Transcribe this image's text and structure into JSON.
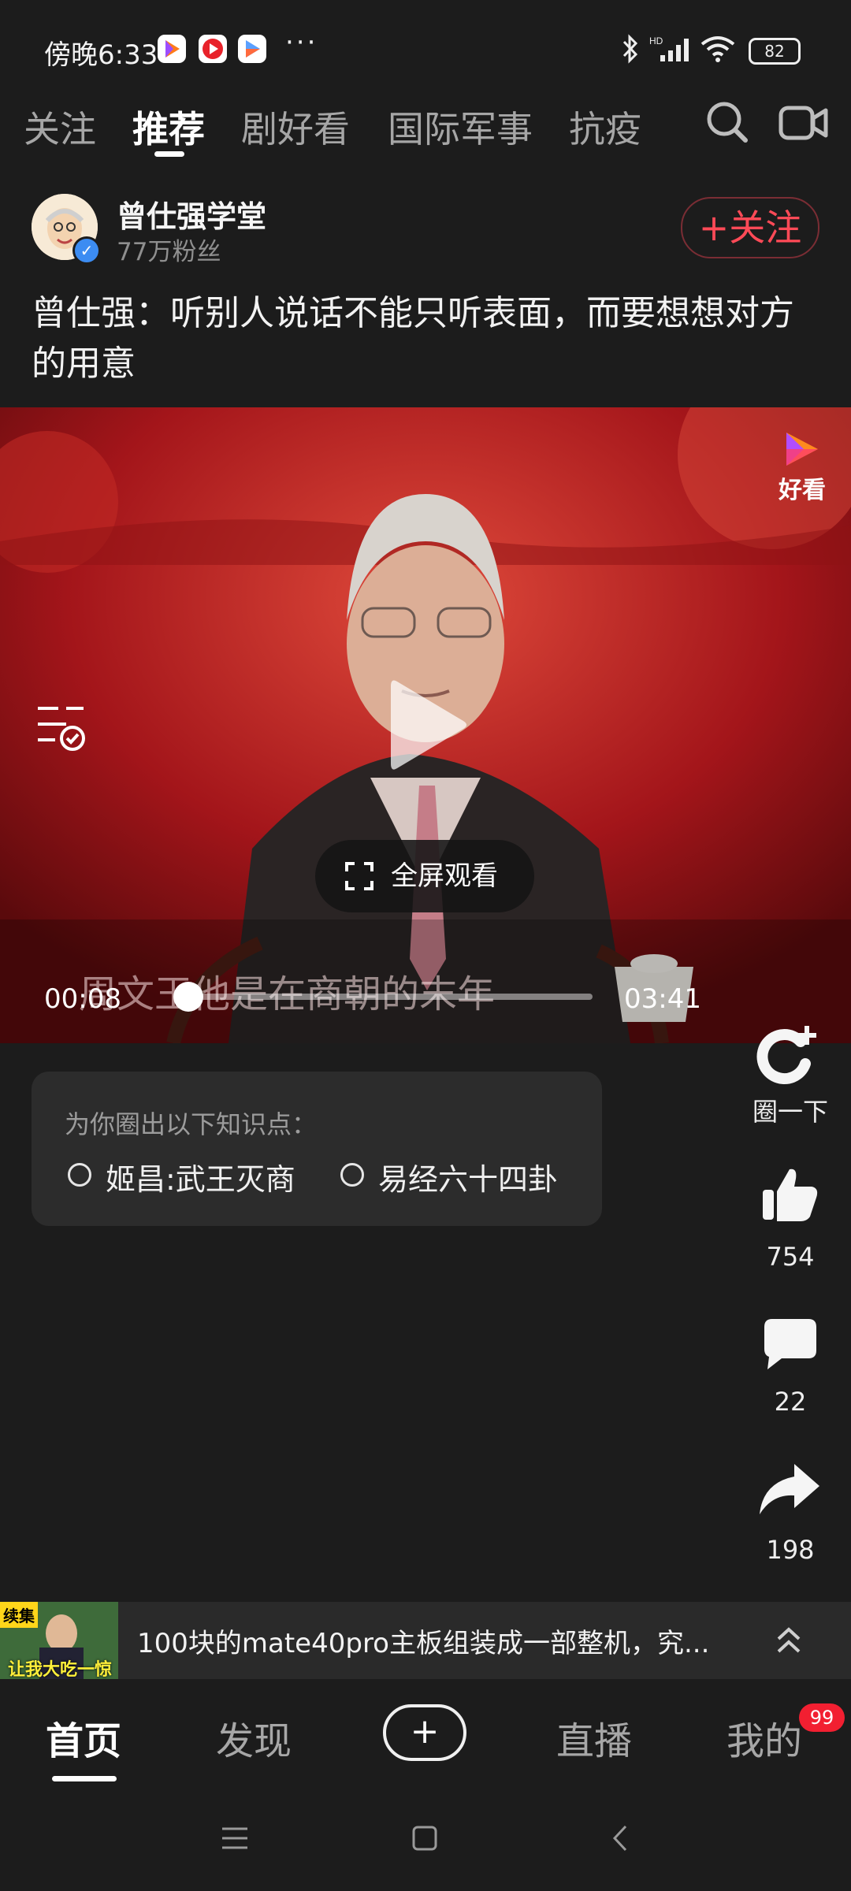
{
  "status_bar": {
    "time": "傍晚6:33",
    "more": "···",
    "battery": "82"
  },
  "top_tabs": [
    "关注",
    "推荐",
    "剧好看",
    "国际军事",
    "抗疫"
  ],
  "author": {
    "name": "曾仕强学堂",
    "fans": "77万粉丝",
    "follow_label": "+关注"
  },
  "video": {
    "title": "曾仕强：听别人说话不能只听表面，而要想想对方的用意",
    "watermark": "好看",
    "fullscreen_label": "全屏观看",
    "subtitle": "周文王他是在商朝的末年",
    "current_time": "00:08",
    "total_time": "03:41",
    "progress": 0.036
  },
  "knowledge": {
    "heading": "为你圈出以下知识点：",
    "items": [
      "姬昌:武王灭商",
      "易经六十四卦"
    ]
  },
  "side_actions": {
    "circle_label": "圈一下",
    "likes": "754",
    "comments": "22",
    "shares": "198"
  },
  "related": {
    "thumb_tag": "续集",
    "thumb_caption": "让我大吃一惊",
    "text": "100块的mate40pro主板组装成一部整机，究..."
  },
  "bottom_nav": {
    "home": "首页",
    "discover": "发现",
    "add": "+",
    "live": "直播",
    "mine": "我的",
    "badge": "99"
  },
  "colors": {
    "accent": "#ff4a57",
    "badge": "#f21f31",
    "background": "#1c1c1c"
  },
  "icons": [
    "bluetooth-icon",
    "signal-icon",
    "wifi-icon",
    "search-icon",
    "video-camera-icon",
    "play-icon",
    "fullscreen-icon",
    "like-icon",
    "comment-icon",
    "share-icon"
  ]
}
